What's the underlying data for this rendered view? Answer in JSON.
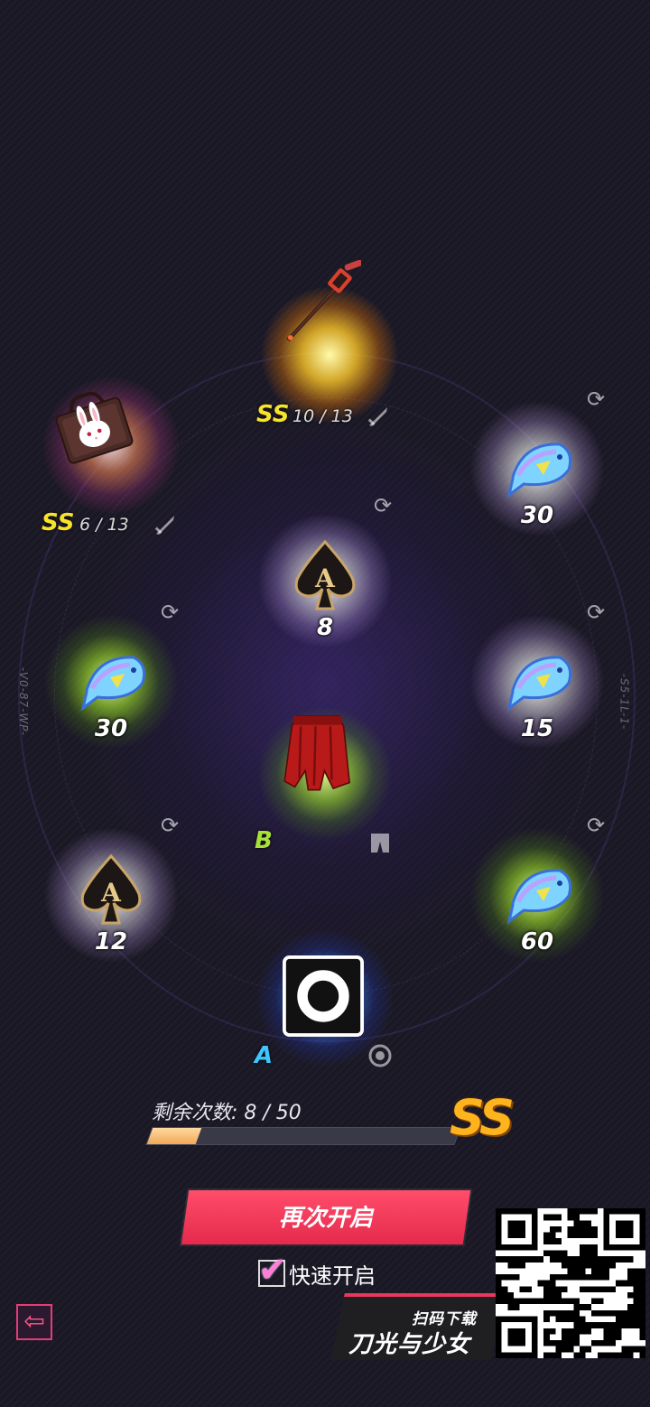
{
  "side_codes": {
    "left": "-V0-87-WP-",
    "right": "-S5-1L-1-"
  },
  "slots": {
    "top": {
      "grade": "SS",
      "progress": "10 / 13",
      "item": "spiked-staff"
    },
    "upper_left": {
      "grade": "SS",
      "progress": "6 / 13",
      "item": "bunny-bag"
    },
    "upper_right": {
      "count": "30",
      "item": "crystal-fish"
    },
    "center_top": {
      "count": "8",
      "item": "spade-ace-card"
    },
    "mid_left": {
      "count": "30",
      "item": "crystal-fish"
    },
    "mid_right": {
      "count": "15",
      "item": "crystal-fish"
    },
    "center": {
      "grade": "B",
      "item": "red-skirt"
    },
    "lower_left": {
      "count": "12",
      "item": "spade-ace-card"
    },
    "lower_right": {
      "count": "60",
      "item": "crystal-fish"
    },
    "bottom": {
      "grade": "A",
      "item": "ring-token"
    }
  },
  "progress": {
    "label": "剩余次数: 8 / 50",
    "current": 8,
    "total": 50,
    "grade": "SS"
  },
  "actions": {
    "reopen_label": "再次开启",
    "quick_open_label": "快速开启",
    "quick_open_checked": true
  },
  "promo": {
    "scan_text": "扫码下载",
    "game_title": "刀光与少女"
  },
  "colors": {
    "accent": "#e52a4c",
    "grade_ss": "#f6e32c",
    "grade_b": "#a8e03a",
    "grade_a": "#3ec6ff",
    "progress_fill": "#f0a858"
  }
}
